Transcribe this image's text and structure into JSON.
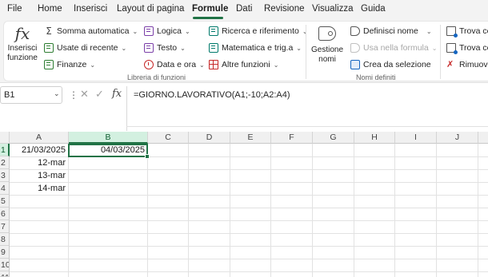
{
  "menu": {
    "tabs": [
      "File",
      "Home",
      "Inserisci",
      "Layout di pagina",
      "Formule",
      "Dati",
      "Revisione",
      "Visualizza",
      "Guida"
    ],
    "active_tab": "Formule"
  },
  "ribbon": {
    "function_library": {
      "insert_function": {
        "symbol": "fx",
        "line1": "Inserisci",
        "line2": "funzione"
      },
      "autosum": "Somma automatica",
      "recent": "Usate di recente",
      "financial": "Finanze",
      "logical": "Logica",
      "text": "Testo",
      "datetime": "Data e ora",
      "lookup": "Ricerca e riferimento",
      "math": "Matematica e trig.a",
      "more": "Altre funzioni",
      "group_label": "Libreria di funzioni"
    },
    "defined_names": {
      "name_manager": {
        "line1": "Gestione",
        "line2": "nomi"
      },
      "define_name": "Definisci nome",
      "use_in_formula": "Usa nella formula",
      "create_from_selection": "Crea da selezione",
      "group_label": "Nomi definiti"
    },
    "auditing": {
      "trace_precedents": "Trova ce",
      "trace_dependents": "Trova ce",
      "remove_arrows": "Rimuovi"
    }
  },
  "formula_bar": {
    "name_box": "B1",
    "formula": "=GIORNO.LAVORATIVO(A1;-10;A2:A4)"
  },
  "grid": {
    "columns": [
      "A",
      "B",
      "C",
      "D",
      "E",
      "F",
      "G",
      "H",
      "I",
      "J"
    ],
    "rows": [
      "1",
      "2",
      "3",
      "4",
      "5",
      "6",
      "7",
      "8",
      "9",
      "10",
      "11"
    ],
    "selected_cell": "B1",
    "cells": {
      "A1": "21/03/2025",
      "B1": "04/03/2025",
      "A2": "12-mar",
      "A3": "13-mar",
      "A4": "14-mar"
    }
  }
}
